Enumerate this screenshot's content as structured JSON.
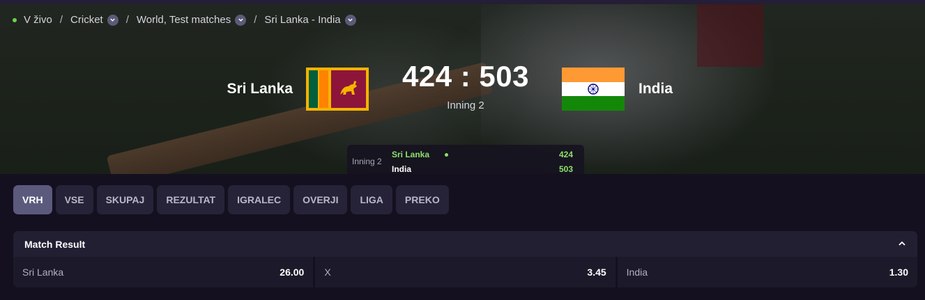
{
  "breadcrumb": {
    "items": [
      "V živo",
      "Cricket",
      "World, Test matches",
      "Sri Lanka - India"
    ]
  },
  "match": {
    "home_team": "Sri Lanka",
    "away_team": "India",
    "score": "424 : 503",
    "inning": "Inning 2",
    "scoreboard": {
      "inning": "Inning 2",
      "rows": [
        {
          "team": "Sri Lanka",
          "score": "424",
          "batting": true
        },
        {
          "team": "India",
          "score": "503",
          "batting": false
        }
      ]
    }
  },
  "tabs": [
    "VRH",
    "VSE",
    "SKUPAJ",
    "REZULTAT",
    "IGRALEC",
    "OVERJI",
    "LIGA",
    "PREKO"
  ],
  "active_tab": "VRH",
  "market": {
    "title": "Match Result",
    "outcomes": [
      {
        "label": "Sri Lanka",
        "odds": "26.00"
      },
      {
        "label": "X",
        "odds": "3.45"
      },
      {
        "label": "India",
        "odds": "1.30"
      }
    ]
  },
  "colors": {
    "live": "#6dd24c",
    "score_green": "#8ee06a",
    "active_tab": "#5b5a7d",
    "background": "#14101f"
  }
}
